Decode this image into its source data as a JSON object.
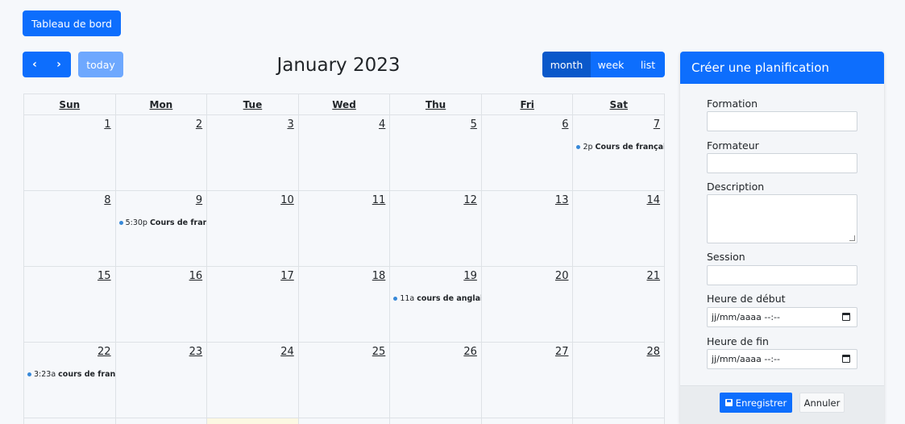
{
  "header": {
    "dashboard_label": "Tableau de bord"
  },
  "toolbar": {
    "prev_icon": "chevron-left-icon",
    "next_icon": "chevron-right-icon",
    "prev_glyph": "‹",
    "next_glyph": "›",
    "today_label": "today",
    "title": "January 2023",
    "views": [
      "month",
      "week",
      "list"
    ],
    "active_view": "month"
  },
  "calendar": {
    "days_of_week": [
      "Sun",
      "Mon",
      "Tue",
      "Wed",
      "Thu",
      "Fri",
      "Sat"
    ],
    "weeks": [
      [
        {
          "num": "1"
        },
        {
          "num": "2"
        },
        {
          "num": "3"
        },
        {
          "num": "4"
        },
        {
          "num": "5"
        },
        {
          "num": "6"
        },
        {
          "num": "7",
          "event": {
            "time": "2p",
            "title": "Cours de français"
          }
        }
      ],
      [
        {
          "num": "8"
        },
        {
          "num": "9",
          "event": {
            "time": "5:30p",
            "title": "Cours de français"
          }
        },
        {
          "num": "10"
        },
        {
          "num": "11"
        },
        {
          "num": "12"
        },
        {
          "num": "13"
        },
        {
          "num": "14"
        }
      ],
      [
        {
          "num": "15"
        },
        {
          "num": "16"
        },
        {
          "num": "17"
        },
        {
          "num": "18"
        },
        {
          "num": "19",
          "event": {
            "time": "11a",
            "title": "cours de anglais"
          }
        },
        {
          "num": "20"
        },
        {
          "num": "21"
        }
      ],
      [
        {
          "num": "22",
          "event": {
            "time": "3:23a",
            "title": "cours de français"
          }
        },
        {
          "num": "23"
        },
        {
          "num": "24"
        },
        {
          "num": "25"
        },
        {
          "num": "26"
        },
        {
          "num": "27"
        },
        {
          "num": "28"
        }
      ],
      [
        {
          "num": ""
        },
        {
          "num": ""
        },
        {
          "num": "",
          "today": true
        },
        {
          "num": ""
        },
        {
          "num": ""
        },
        {
          "num": ""
        },
        {
          "num": ""
        }
      ]
    ],
    "event_color": "#3788d8"
  },
  "panel": {
    "title": "Créer une planification",
    "fields": {
      "formation_label": "Formation",
      "formateur_label": "Formateur",
      "description_label": "Description",
      "session_label": "Session",
      "start_label": "Heure de début",
      "start_placeholder": "jj/mm/aaaa --:--",
      "end_label": "Heure de fin",
      "end_placeholder": "jj/mm/aaaa --:--"
    },
    "save_label": "Enregistrer",
    "save_icon": "save-icon",
    "cancel_label": "Annuler"
  },
  "colors": {
    "primary": "#0d6efd",
    "primary_active": "#0a58ca",
    "today_bg": "#fcf8e3"
  }
}
